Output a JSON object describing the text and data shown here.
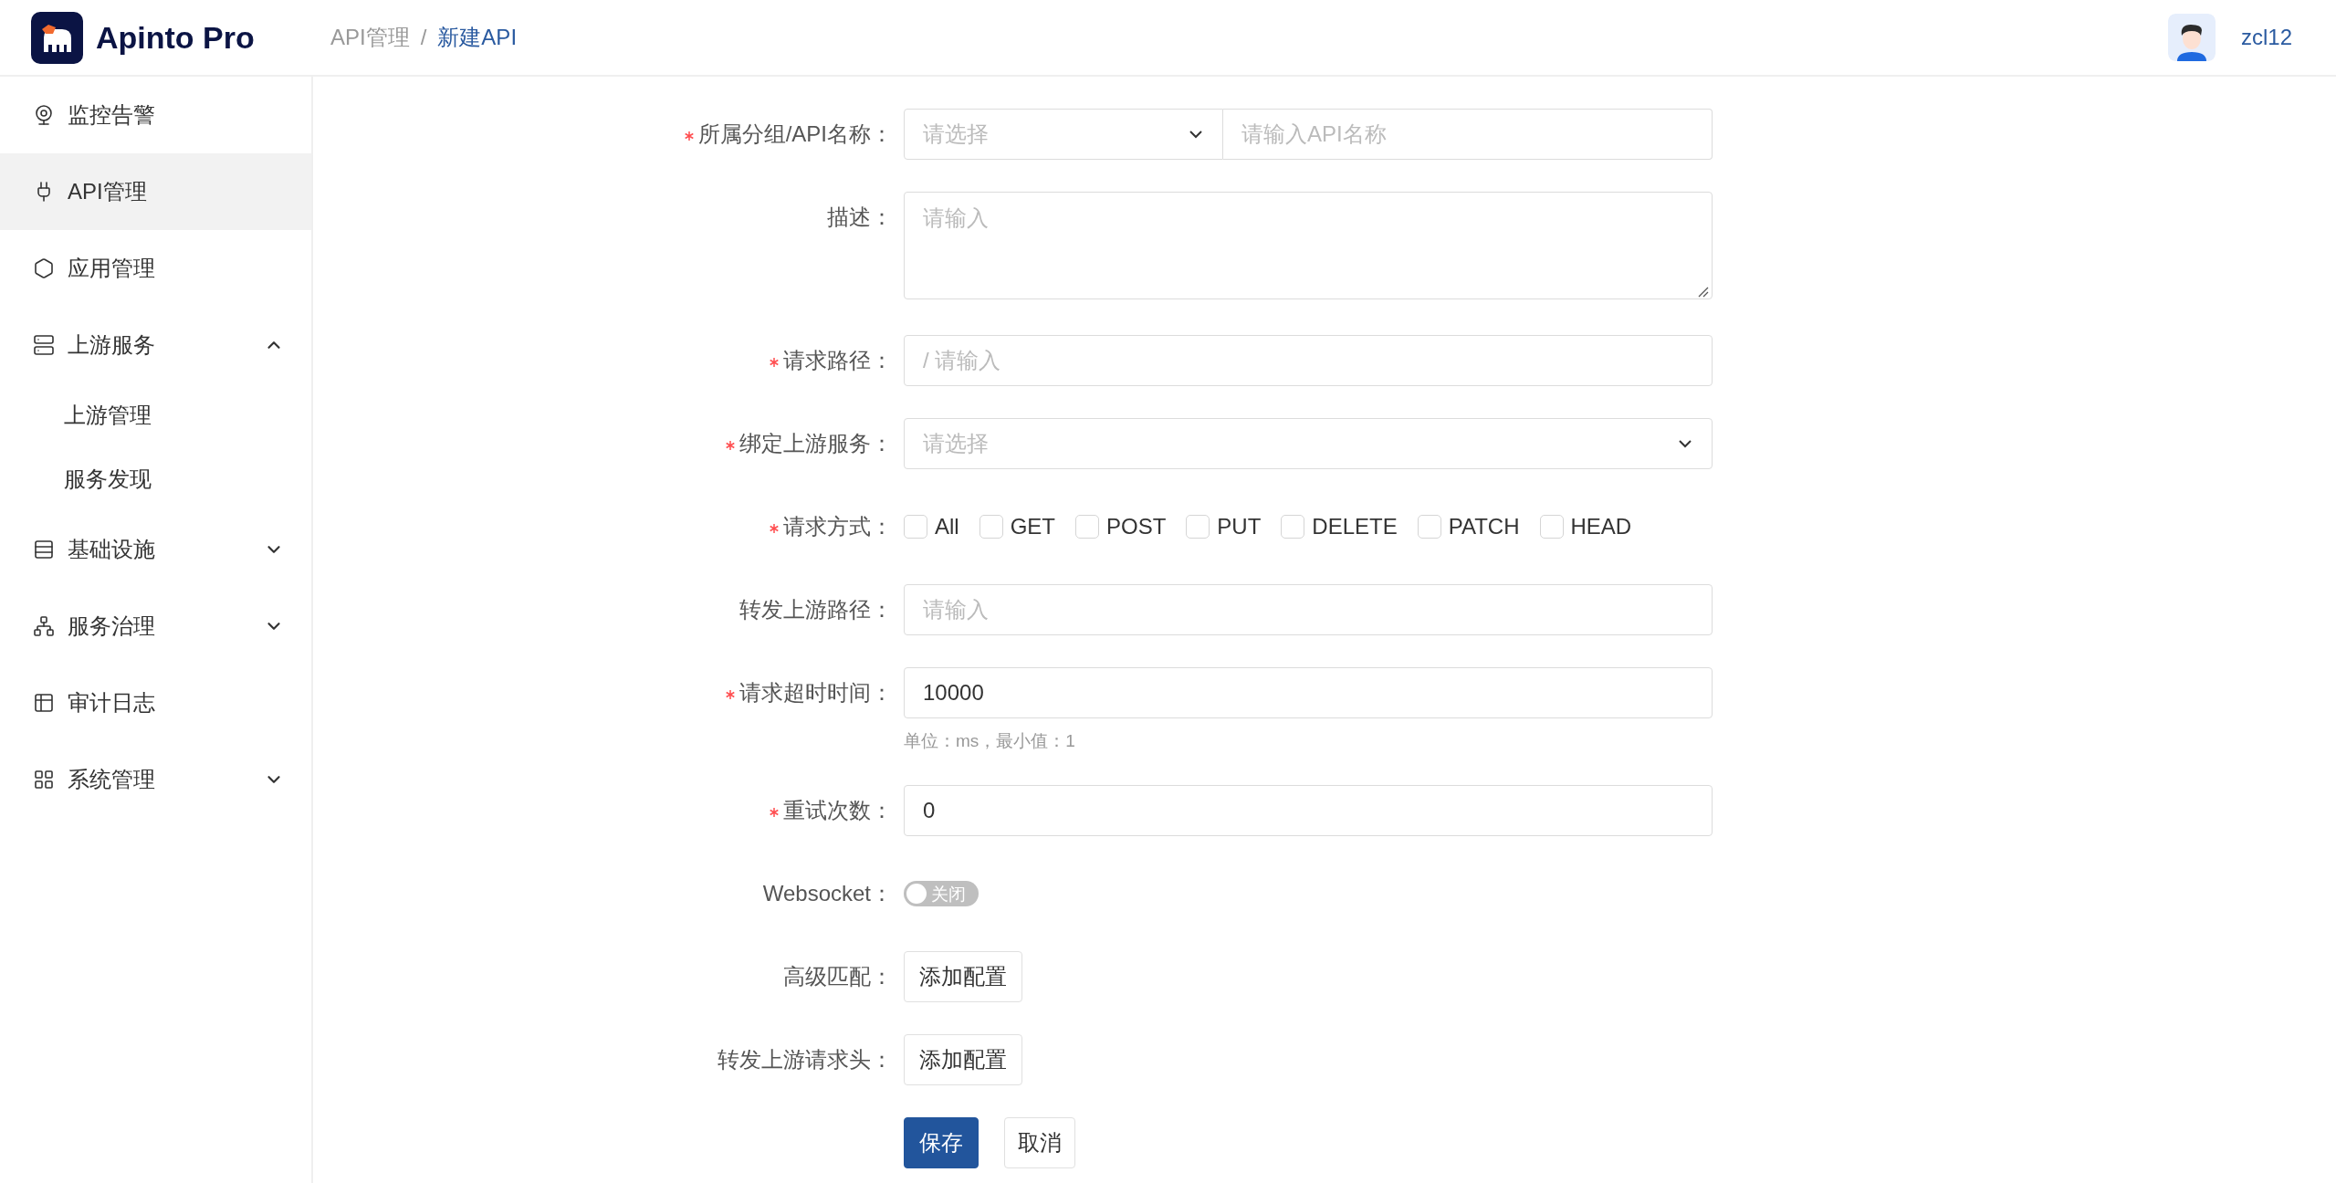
{
  "header": {
    "logo_text": "Apinto Pro",
    "breadcrumb": [
      {
        "label": "API管理",
        "selected": false
      },
      {
        "label": "新建API",
        "selected": true
      }
    ],
    "separator": "/",
    "user": {
      "name": "zcl12"
    }
  },
  "sidebar": {
    "items": [
      {
        "label": "监控告警",
        "selected": false
      },
      {
        "label": "API管理",
        "selected": true
      },
      {
        "label": "应用管理",
        "selected": false
      },
      {
        "label": "上游服务",
        "selected": false,
        "expanded": true,
        "children": [
          {
            "label": "上游管理",
            "selected": false
          },
          {
            "label": "服务发现",
            "selected": false
          }
        ]
      },
      {
        "label": "基础设施",
        "selected": false,
        "expanded": false
      },
      {
        "label": "服务治理",
        "selected": false,
        "expanded": false
      },
      {
        "label": "审计日志",
        "selected": false
      },
      {
        "label": "系统管理",
        "selected": false,
        "expanded": false
      }
    ]
  },
  "form": {
    "rows": [
      {
        "kind": "combo",
        "label": "所属分组/API名称：",
        "required": true,
        "select_placeholder": "请选择",
        "placeholder": "请输入API名称"
      },
      {
        "kind": "textarea",
        "label": "描述：",
        "required": false,
        "placeholder": "请输入"
      },
      {
        "kind": "input",
        "label": "请求路径：",
        "required": true,
        "placeholder": "/ 请输入"
      },
      {
        "kind": "select",
        "label": "绑定上游服务：",
        "required": true,
        "placeholder": "请选择"
      },
      {
        "kind": "checkboxes",
        "label": "请求方式：",
        "required": true,
        "options": [
          {
            "label": "All",
            "checked": false
          },
          {
            "label": "GET",
            "checked": false
          },
          {
            "label": "POST",
            "checked": false
          },
          {
            "label": "PUT",
            "checked": false
          },
          {
            "label": "DELETE",
            "checked": false
          },
          {
            "label": "PATCH",
            "checked": false
          },
          {
            "label": "HEAD",
            "checked": false
          }
        ]
      },
      {
        "kind": "input",
        "label": "转发上游路径：",
        "required": false,
        "placeholder": "请输入"
      },
      {
        "kind": "input",
        "label": "请求超时时间：",
        "required": true,
        "value": "10000",
        "hint": "单位：ms，最小值：1"
      },
      {
        "kind": "input",
        "label": "重试次数：",
        "required": true,
        "value": "0"
      },
      {
        "kind": "switch",
        "label": "Websocket：",
        "required": false,
        "on": false,
        "text": "关闭"
      },
      {
        "kind": "button",
        "label": "高级匹配：",
        "required": false,
        "button": "添加配置"
      },
      {
        "kind": "button",
        "label": "转发上游请求头：",
        "required": false,
        "button": "添加配置"
      }
    ],
    "actions": [
      {
        "label": "保存",
        "kind": "primary"
      },
      {
        "label": "取消",
        "kind": "default"
      }
    ]
  }
}
